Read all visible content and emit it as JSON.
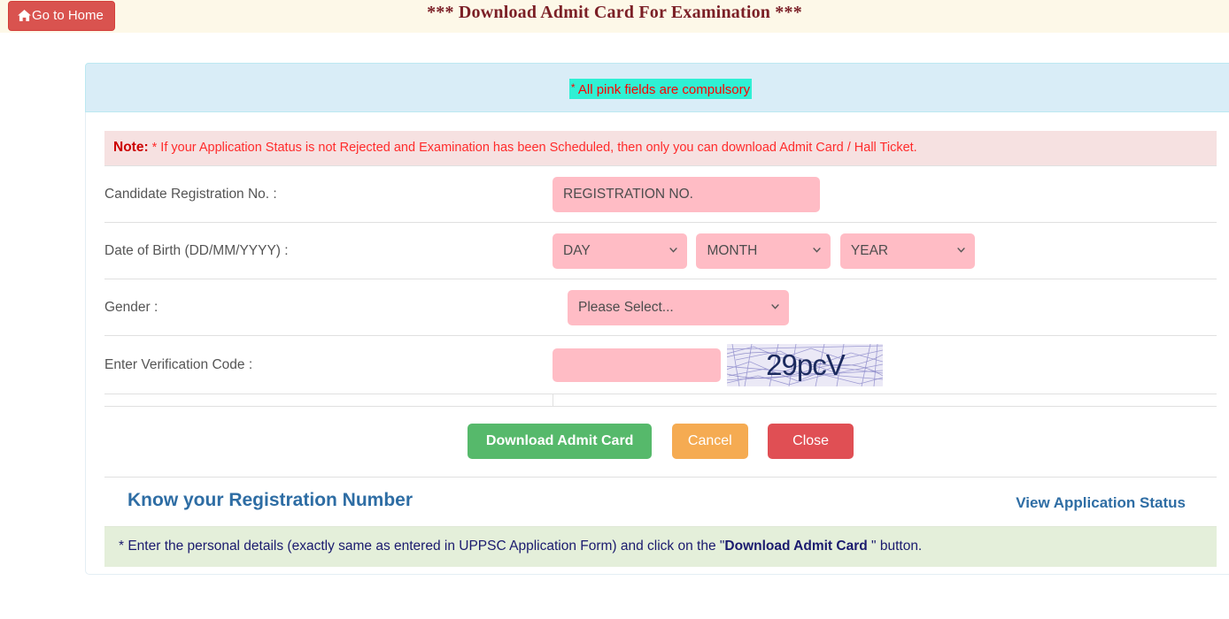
{
  "header": {
    "home_button_label": "Go to Home",
    "home_icon": "home-icon",
    "title": "*** Download Admit Card For Examination ***"
  },
  "panel": {
    "compulsory_star": "*",
    "compulsory_text": " All pink fields are compulsory"
  },
  "note": {
    "label": "Note:",
    "text": " * If your Application Status is not Rejected and Examination has been Scheduled, then only you can download Admit Card / Hall Ticket."
  },
  "form": {
    "registration": {
      "label": "Candidate Registration No. :",
      "placeholder": "REGISTRATION NO.",
      "value": ""
    },
    "dob": {
      "label": "Date of Birth (DD/MM/YYYY) :",
      "day": "DAY",
      "month": "MONTH",
      "year": "YEAR"
    },
    "gender": {
      "label": "Gender :",
      "selected": "Please Select..."
    },
    "verification": {
      "label": "Enter Verification Code :",
      "placeholder": "",
      "value": "",
      "captcha_text": "29pcV"
    }
  },
  "buttons": {
    "download": "Download Admit Card",
    "cancel": "Cancel",
    "close": "Close"
  },
  "links": {
    "know_registration": "Know your Registration Number",
    "view_status": "View Application Status"
  },
  "footer": {
    "prefix": "* Enter the personal details (exactly same as entered in UPPSC Application Form) and click on the \"",
    "bold": "Download Admit Card ",
    "suffix": "\" button."
  },
  "colors": {
    "header_bg": "#fdf8e8",
    "title": "#7b1f26",
    "home_btn": "#d9534f",
    "panel_head_bg": "#d9edf7",
    "compulsory_highlight": "#2ff0d4",
    "compulsory_text": "#ff0000",
    "note_bg": "#f6e1e1",
    "note_text": "#ff2b2b",
    "pink_field": "#ffbcc5",
    "download_btn": "#56b96b",
    "cancel_btn": "#f5ab52",
    "close_btn": "#e04f54",
    "link": "#2e6da4",
    "footer_bg": "#e4efda",
    "footer_text": "#1a1a6e"
  }
}
